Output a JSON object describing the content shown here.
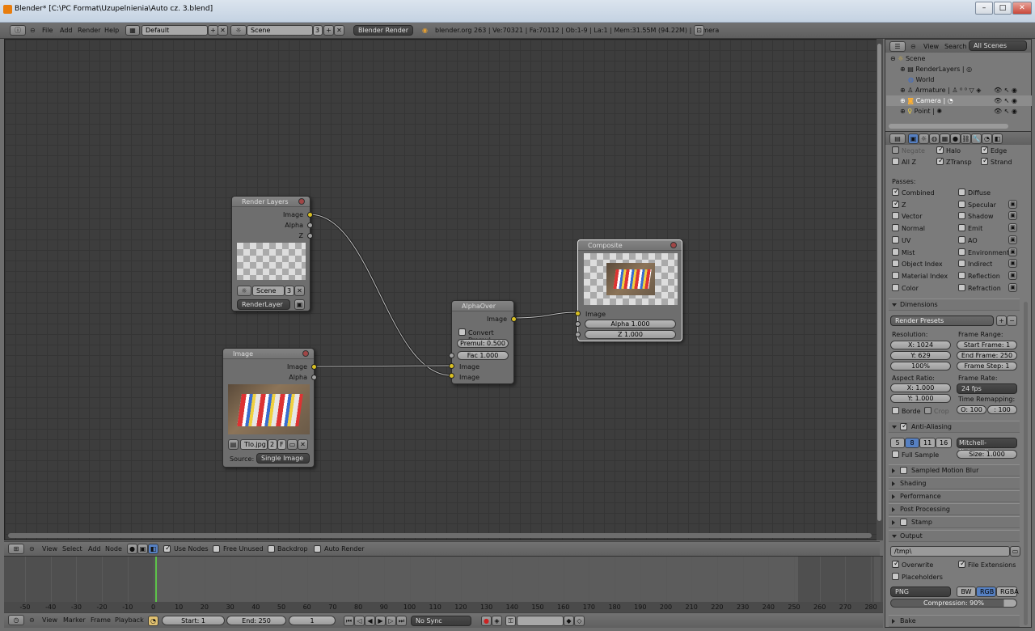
{
  "window": {
    "title": "Blender* [C:\\PC Format\\Uzupelnienia\\Auto cz. 3.blend]",
    "min": "–",
    "max": "□",
    "close": "✕"
  },
  "topbar": {
    "menus": [
      "File",
      "Add",
      "Render",
      "Help"
    ],
    "layout": "Default",
    "scene": "Scene",
    "scene_users": "3",
    "engine": "Blender Render",
    "stats": "blender.org 263 | Ve:70321 | Fa:70112 | Ob:1-9 | La:1 | Mem:31.55M (94.22M) | Camera"
  },
  "nodes": {
    "render_layers": {
      "title": "Render Layers",
      "outputs": [
        "Image",
        "Alpha",
        "Z"
      ],
      "scene": "Scene",
      "scene_num": "3",
      "layer": "RenderLayer"
    },
    "image": {
      "title": "Image",
      "outputs": [
        "Image",
        "Alpha"
      ],
      "file": "Tlo.jpg",
      "users": "2",
      "fake": "F",
      "source_label": "Source:",
      "source": "Single Image"
    },
    "alphaover": {
      "title": "AlphaOver",
      "output": "Image",
      "convert": "Convert Premul",
      "premul": "Premul: 0.500",
      "fac": "Fac 1.000",
      "in1": "Image",
      "in2": "Image"
    },
    "composite": {
      "title": "Composite",
      "input": "Image",
      "alpha": "Alpha 1.000",
      "z": "Z 1.000"
    }
  },
  "node_header": {
    "menus": [
      "View",
      "Select",
      "Add",
      "Node"
    ],
    "use_nodes": "Use Nodes",
    "free_unused": "Free Unused",
    "backdrop": "Backdrop",
    "auto_render": "Auto Render"
  },
  "timeline": {
    "ticks": [
      "-50",
      "-40",
      "-30",
      "-20",
      "-10",
      "0",
      "10",
      "20",
      "30",
      "40",
      "50",
      "60",
      "70",
      "80",
      "90",
      "100",
      "110",
      "120",
      "130",
      "140",
      "150",
      "160",
      "170",
      "180",
      "190",
      "200",
      "210",
      "220",
      "230",
      "240",
      "250",
      "260",
      "270",
      "280"
    ],
    "menus": [
      "View",
      "Marker",
      "Frame",
      "Playback"
    ],
    "start": "Start: 1",
    "end": "End: 250",
    "current": "1",
    "sync": "No Sync"
  },
  "outliner": {
    "menus": [
      "View",
      "Search"
    ],
    "filter": "All Scenes",
    "items": [
      {
        "label": "Scene"
      },
      {
        "label": "RenderLayers"
      },
      {
        "label": "World"
      },
      {
        "label": "Armature"
      },
      {
        "label": "Camera"
      },
      {
        "label": "Point"
      }
    ]
  },
  "props": {
    "layer_opts": {
      "negate": "Negate",
      "halo": "Halo",
      "edge": "Edge",
      "allz": "All Z",
      "ztransp": "ZTransp",
      "strand": "Strand"
    },
    "passes_label": "Passes:",
    "passes_left": [
      "Combined",
      "Z",
      "Vector",
      "Normal",
      "UV",
      "Mist",
      "Object Index",
      "Material Index",
      "Color"
    ],
    "passes_right": [
      "Diffuse",
      "Specular",
      "Shadow",
      "Emit",
      "AO",
      "Environment",
      "Indirect",
      "Reflection",
      "Refraction"
    ],
    "dimensions": "Dimensions",
    "presets": "Render Presets",
    "resolution": "Resolution:",
    "res_x": "X: 1024",
    "res_y": "Y: 629",
    "res_pct": "100%",
    "frame_range": "Frame Range:",
    "start_frame": "Start Frame: 1",
    "end_frame": "End Frame: 250",
    "frame_step": "Frame Step: 1",
    "aspect": "Aspect Ratio:",
    "asp_x": "X: 1.000",
    "asp_y": "Y: 1.000",
    "border": "Borde",
    "crop": "Crop",
    "frame_rate": "Frame Rate:",
    "fps": "24 fps",
    "time_remap": "Time Remapping:",
    "remap_old": "O: 100",
    "remap_new": ": 100",
    "antialias": "Anti-Aliasing",
    "aa_samples": [
      "5",
      "8",
      "11",
      "16"
    ],
    "aa_filter": "Mitchell-Netravali",
    "full_sample": "Full Sample",
    "aa_size": "Size: 1.000",
    "panels": [
      "Sampled Motion Blur",
      "Shading",
      "Performance",
      "Post Processing",
      "Stamp"
    ],
    "output": "Output",
    "path": "/tmp\\",
    "overwrite": "Overwrite",
    "file_ext": "File Extensions",
    "placeholders": "Placeholders",
    "format": "PNG",
    "bw": "BW",
    "rgb": "RGB",
    "rgba": "RGBA",
    "compression": "Compression: 90%",
    "bake": "Bake"
  }
}
